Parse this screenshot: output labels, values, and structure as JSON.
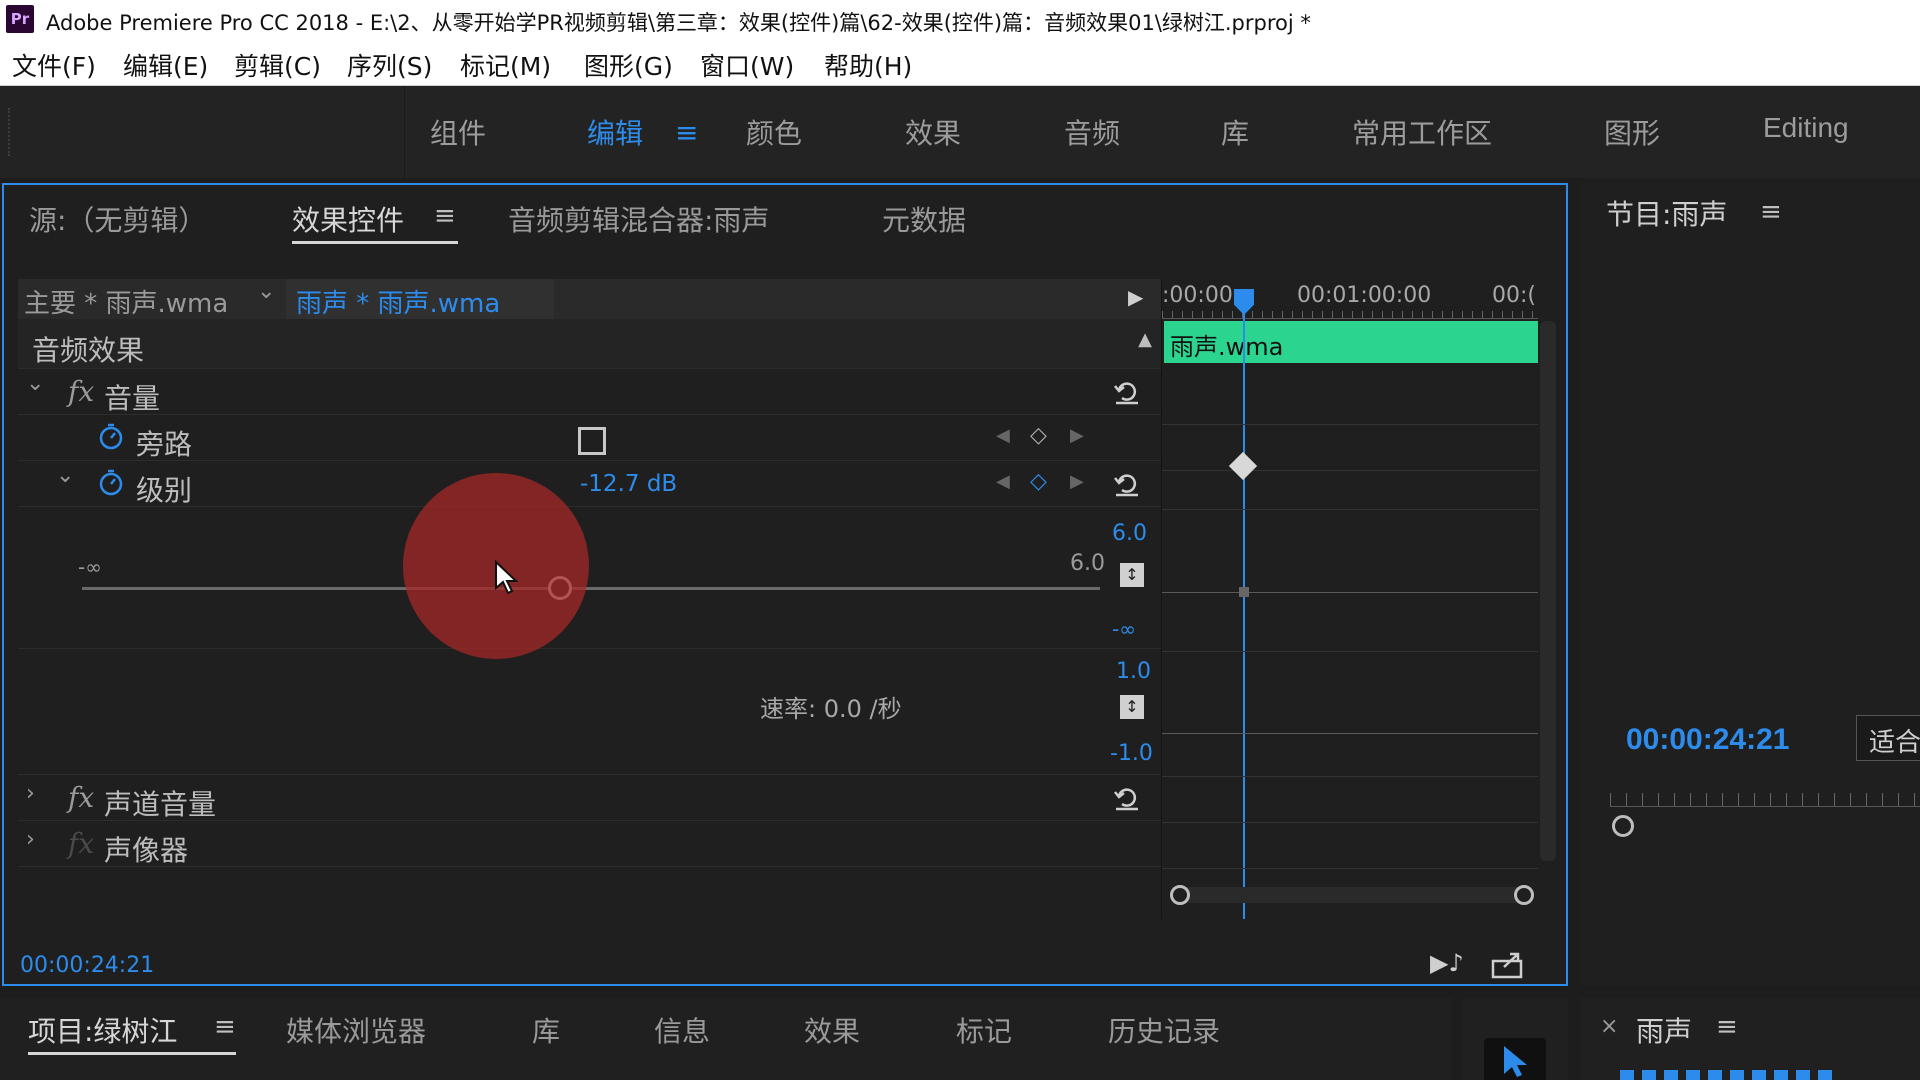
{
  "window": {
    "logo_text": "Pr",
    "title": "Adobe Premiere Pro CC 2018 - E:\\2、从零开始学PR视频剪辑\\第三章：效果(控件)篇\\62-效果(控件)篇：音频效果01\\绿树江.prproj *"
  },
  "menu": [
    "文件(F)",
    "编辑(E)",
    "剪辑(C)",
    "序列(S)",
    "标记(M)",
    "图形(G)",
    "窗口(W)",
    "帮助(H)"
  ],
  "workspaces": {
    "tabs": [
      "组件",
      "编辑",
      "颜色",
      "效果",
      "音频",
      "库",
      "常用工作区",
      "图形",
      "Editing"
    ],
    "active": "编辑",
    "menu_glyph": "≡"
  },
  "effect_panel": {
    "tabs": [
      "源:（无剪辑）",
      "效果控件",
      "音频剪辑混合器:雨声",
      "元数据"
    ],
    "active_tab": "效果控件",
    "master_clip": "主要 * 雨声.wma",
    "active_clip": "雨声 * 雨声.wma",
    "section_title": "音频效果",
    "effects": {
      "volume": {
        "fx": "fx",
        "name": "音量",
        "bypass_label": "旁路",
        "level_label": "级别",
        "level_value": "-12.7 dB",
        "slider_min": "-∞",
        "slider_max": "6.0",
        "slider_fraction": 0.47,
        "graph_top": "6.0",
        "graph_bottom": "-∞",
        "velocity_top": "1.0",
        "velocity_bottom": "-1.0",
        "velocity_text": "速率: 0.0 /秒"
      },
      "channel_volume": {
        "fx": "fx",
        "name": "声道音量"
      },
      "panner": {
        "fx": "fx",
        "name": "声像器"
      }
    },
    "timeline": {
      "ruler_labels": [
        ":00:00",
        "00:01:00:00",
        "00:("
      ],
      "clip_label": "雨声.wma",
      "clip_color": "#2bd58f"
    },
    "timecode": "00:00:24:21"
  },
  "program_panel": {
    "title": "节目:雨声",
    "timecode": "00:00:24:21",
    "fit_label": "适合"
  },
  "bottom_tabs": [
    "项目:绿树江",
    "媒体浏览器",
    "库",
    "信息",
    "效果",
    "标记",
    "历史记录"
  ],
  "bottom_active": "项目:绿树江",
  "bottom_right": {
    "close": "×",
    "title": "雨声"
  },
  "colors": {
    "accent": "#2d8ceb",
    "panel_bg": "#1f1f1f",
    "clip_green": "#2bd58f"
  },
  "icons": [
    "stopwatch-icon",
    "reset-icon",
    "keyframe-diamond-icon",
    "checkbox-icon",
    "play-arrow-icon",
    "export-icon",
    "selection-tool-icon"
  ]
}
